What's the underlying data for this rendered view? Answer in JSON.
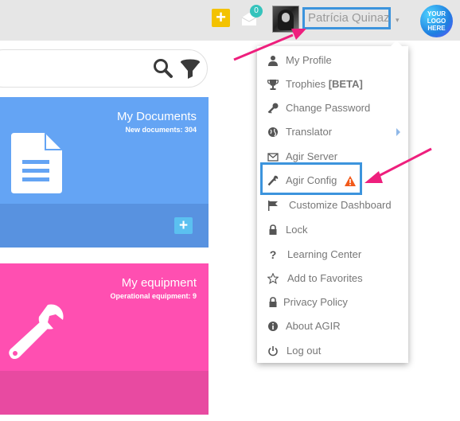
{
  "topbar": {
    "inbox_badge": "0",
    "user_name": "Patrícia Quinaz",
    "logo_text": "YOUR LOGO HERE"
  },
  "cards": {
    "documents": {
      "title": "My Documents",
      "subtitle": "New documents: 304"
    },
    "equipment": {
      "title": "My equipment",
      "subtitle": "Operational equipment: 9"
    }
  },
  "menu": {
    "items": [
      {
        "icon": "user-icon",
        "label": "My Profile"
      },
      {
        "icon": "trophy-icon",
        "label": "Trophies ",
        "badge": "[BETA]"
      },
      {
        "icon": "key-icon",
        "label": "Change Password"
      },
      {
        "icon": "globe-icon",
        "label": "Translator"
      },
      {
        "icon": "envelope-icon",
        "label": "Agir Server"
      },
      {
        "icon": "wrench-icon",
        "label": "Agir Config"
      },
      {
        "icon": "flag-icon",
        "label": "Customize Dashboard"
      },
      {
        "icon": "lock-icon",
        "label": "Lock"
      },
      {
        "icon": "question-icon",
        "label": "Learning Center"
      },
      {
        "icon": "star-icon",
        "label": "Add to Favorites"
      },
      {
        "icon": "lock-icon",
        "label": "Privacy Policy"
      },
      {
        "icon": "info-icon",
        "label": "About AGIR"
      },
      {
        "icon": "power-icon",
        "label": "Log out"
      }
    ]
  },
  "colors": {
    "documents_card": "#64a4f4",
    "equipment_card": "#ff4fb1",
    "highlight": "#3c94dd",
    "annotation_arrow": "#ee1f7d",
    "warning": "#f25a1a"
  }
}
